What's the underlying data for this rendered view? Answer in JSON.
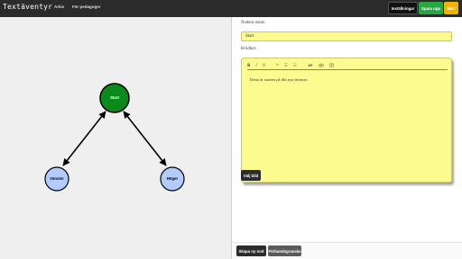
{
  "app": {
    "brand": "Textäventyr",
    "nav": [
      "Arkiv",
      "För pedagoger"
    ]
  },
  "header_buttons": {
    "settings": "Inställningar",
    "save": "Spara upp",
    "quit": "Bort"
  },
  "graph": {
    "nodes": [
      {
        "id": "start",
        "label": "Start",
        "fill": "#0a8a1a",
        "text_color": "#ffffff"
      },
      {
        "id": "vanster",
        "label": "Vänster",
        "fill": "#b3ccff",
        "text_color": "#000000"
      },
      {
        "id": "hoger",
        "label": "Höger",
        "fill": "#b3ccff",
        "text_color": "#000000"
      }
    ],
    "edges": [
      {
        "from": "start",
        "to": "vanster"
      },
      {
        "from": "start",
        "to": "hoger"
      }
    ]
  },
  "panel": {
    "node_name_label": "Nodens namn",
    "node_name_value": "Start",
    "description_label": "Brödtext",
    "toolbar_icons": [
      "bold-icon",
      "italic-icon",
      "heading-icon",
      "quote-icon",
      "unordered-list-icon",
      "ordered-list-icon",
      "link-icon",
      "preview-eye-icon",
      "help-icon"
    ],
    "toolbar_glyphs": [
      "B",
      "I",
      "H",
      "❝",
      "☰",
      "☷",
      "🔗",
      "👁",
      "?"
    ],
    "body_text": "Detta är starten på ditt nya äventyr.",
    "choose_button": "Välj bild",
    "new_node_button": "Skapa ny nod",
    "preview_button": "Förhandsgranska"
  },
  "colors": {
    "topbar": "#2b2b2b",
    "editor_bg": "#fbfb8f",
    "save_green": "#28a745",
    "quit_yellow": "#f0b400"
  }
}
